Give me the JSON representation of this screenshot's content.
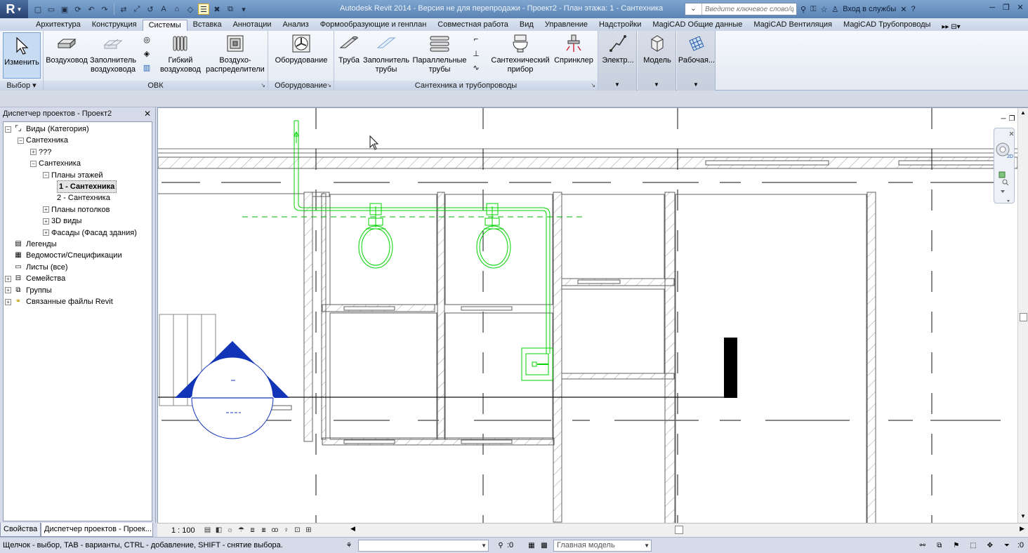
{
  "titlebar": {
    "app_logo": "R",
    "title": "Autodesk Revit 2014 - Версия не для перепродажи -     Проект2 - План этажа: 1 - Сантехника",
    "search_placeholder": "Введите ключевое слово/фразу",
    "login_label": "Вход в службы",
    "icons": [
      "new-icon",
      "open-icon",
      "save-icon",
      "sync-icon",
      "undo-icon",
      "redo-icon",
      "measure-icon",
      "dimension-icon",
      "tag-icon",
      "text-icon",
      "3d-view-icon",
      "section-icon",
      "thin-lines-icon",
      "close-hidden-icon",
      "switch-windows-icon",
      "customize-qat-icon"
    ]
  },
  "ribbon_tabs": [
    {
      "label": "Архитектура"
    },
    {
      "label": "Конструкция"
    },
    {
      "label": "Системы",
      "active": true
    },
    {
      "label": "Вставка"
    },
    {
      "label": "Аннотации"
    },
    {
      "label": "Анализ"
    },
    {
      "label": "Формообразующие и генплан"
    },
    {
      "label": "Совместная работа"
    },
    {
      "label": "Вид"
    },
    {
      "label": "Управление"
    },
    {
      "label": "Надстройки"
    },
    {
      "label": "MagiCAD Общие данные"
    },
    {
      "label": "MagiCAD Вентиляция"
    },
    {
      "label": "MagiCAD Трубопроводы"
    }
  ],
  "ribbon": {
    "select_panel": {
      "button": "Изменить",
      "label": "Выбор"
    },
    "hvac_panel": {
      "label": "ОВК",
      "duct": "Воздуховод",
      "duct_placeholder": "Заполнитель воздуховода",
      "flex_duct": "Гибкий воздуховод",
      "air_terminal": "Воздухо- распределители"
    },
    "mech_panel": {
      "label": "Оборудование",
      "equipment": "Оборудование"
    },
    "plumbing_panel": {
      "label": "Сантехника и трубопроводы",
      "pipe": "Труба",
      "pipe_placeholder": "Заполнитель трубы",
      "parallel_pipes": "Параллельные трубы",
      "fixture": "Сантехнический прибор",
      "sprinkler": "Спринклер"
    },
    "electrical": "Электр...",
    "model": "Модель",
    "workplane": "Рабочая..."
  },
  "browser": {
    "title": "Диспетчер проектов - Проект2",
    "close": "✕",
    "tree": [
      {
        "label": "Виды (Категория)",
        "level": 0,
        "exp": "−",
        "icon": "views-icon"
      },
      {
        "label": "Сантехника",
        "level": 1,
        "exp": "−"
      },
      {
        "label": "???",
        "level": 2,
        "exp": "+"
      },
      {
        "label": "Сантехника",
        "level": 2,
        "exp": "−"
      },
      {
        "label": "Планы этажей",
        "level": 3,
        "exp": "−"
      },
      {
        "label": "1 - Сантехника",
        "level": 4,
        "selected": true
      },
      {
        "label": "2 - Сантехника",
        "level": 4
      },
      {
        "label": "Планы потолков",
        "level": 3,
        "exp": "+"
      },
      {
        "label": "3D виды",
        "level": 3,
        "exp": "+"
      },
      {
        "label": "Фасады (Фасад здания)",
        "level": 3,
        "exp": "+"
      },
      {
        "label": "Легенды",
        "level": 0,
        "icon": "legend-icon"
      },
      {
        "label": "Ведомости/Спецификации",
        "level": 0,
        "icon": "schedule-icon"
      },
      {
        "label": "Листы (все)",
        "level": 0,
        "icon": "sheet-icon"
      },
      {
        "label": "Семейства",
        "level": 0,
        "exp": "+",
        "icon": "family-icon"
      },
      {
        "label": "Группы",
        "level": 0,
        "exp": "+",
        "icon": "group-icon"
      },
      {
        "label": "Связанные файлы Revit",
        "level": 0,
        "exp": "+",
        "icon": "link-icon"
      }
    ],
    "tabs": [
      "Свойства",
      "Диспетчер проектов - Проек..."
    ]
  },
  "viewbar": {
    "scale": "1 : 100"
  },
  "status": {
    "hint": "Щелчок - выбор, TAB - варианты, CTRL - добавление, SHIFT - снятие выбора.",
    "worksets_value": ":0",
    "design_option": "Главная модель",
    "filter_count": ":0"
  },
  "colors": {
    "accent": "#5a83b4",
    "pipe": "#00d400",
    "wall": "#606060",
    "symbol": "#1235b8"
  }
}
